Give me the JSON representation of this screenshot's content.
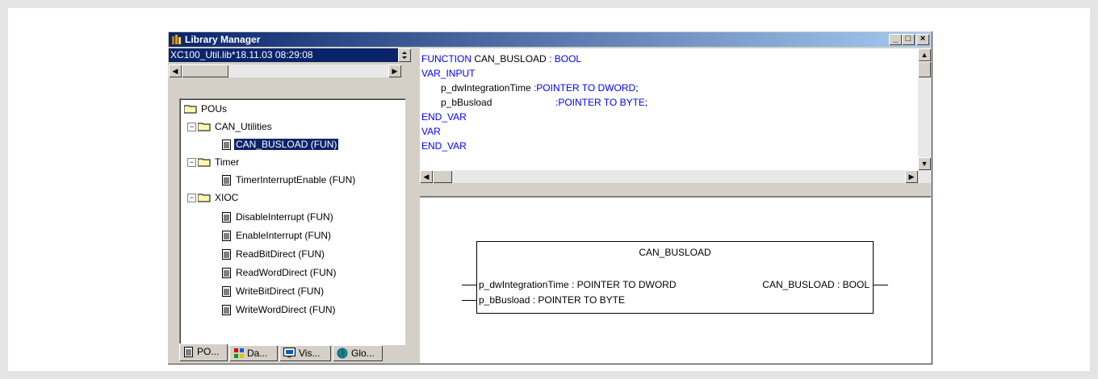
{
  "window": {
    "title": "Library Manager",
    "buttons": {
      "minimize": "_",
      "maximize": "□",
      "close": "×"
    }
  },
  "library_combo": {
    "value": "XC100_Util.lib*18.11.03 08:29:08"
  },
  "tree": {
    "root": "POUs",
    "groups": [
      {
        "name": "CAN_Utilities",
        "items": [
          "CAN_BUSLOAD (FUN)"
        ]
      },
      {
        "name": "Timer",
        "items": [
          "TimerInterruptEnable (FUN)"
        ]
      },
      {
        "name": "XIOC",
        "items": [
          "DisableInterrupt (FUN)",
          "EnableInterrupt (FUN)",
          "ReadBitDirect (FUN)",
          "ReadWordDirect (FUN)",
          "WriteBitDirect (FUN)",
          "WriteWordDirect (FUN)"
        ]
      }
    ],
    "selected": "CAN_BUSLOAD (FUN)"
  },
  "tabs": [
    {
      "label": "PO...",
      "icon": "document-icon"
    },
    {
      "label": "Da...",
      "icon": "datatype-icon"
    },
    {
      "label": "Vis...",
      "icon": "visualization-icon"
    },
    {
      "label": "Glo...",
      "icon": "globe-icon"
    }
  ],
  "code": {
    "line1_kw": "FUNCTION",
    "line1_name": "CAN_BUSLOAD",
    "line1_type": ": BOOL",
    "var_input": "VAR_INPUT",
    "var1_name": "p_dwIntegrationTime",
    "var1_type": ":POINTER TO DWORD",
    "var2_name": "p_bBusload",
    "var2_type": ":POINTER TO BYTE",
    "end_var": "END_VAR",
    "var": "VAR",
    "end_var2": "END_VAR"
  },
  "block": {
    "name": "CAN_BUSLOAD",
    "input1": "p_dwIntegrationTime : POINTER TO DWORD",
    "input2": "p_bBusload : POINTER TO BYTE",
    "output": "CAN_BUSLOAD : BOOL"
  },
  "colors": {
    "titlebar": "#0a246a",
    "keyword": "#0000ff",
    "selection": "#0a246a"
  }
}
